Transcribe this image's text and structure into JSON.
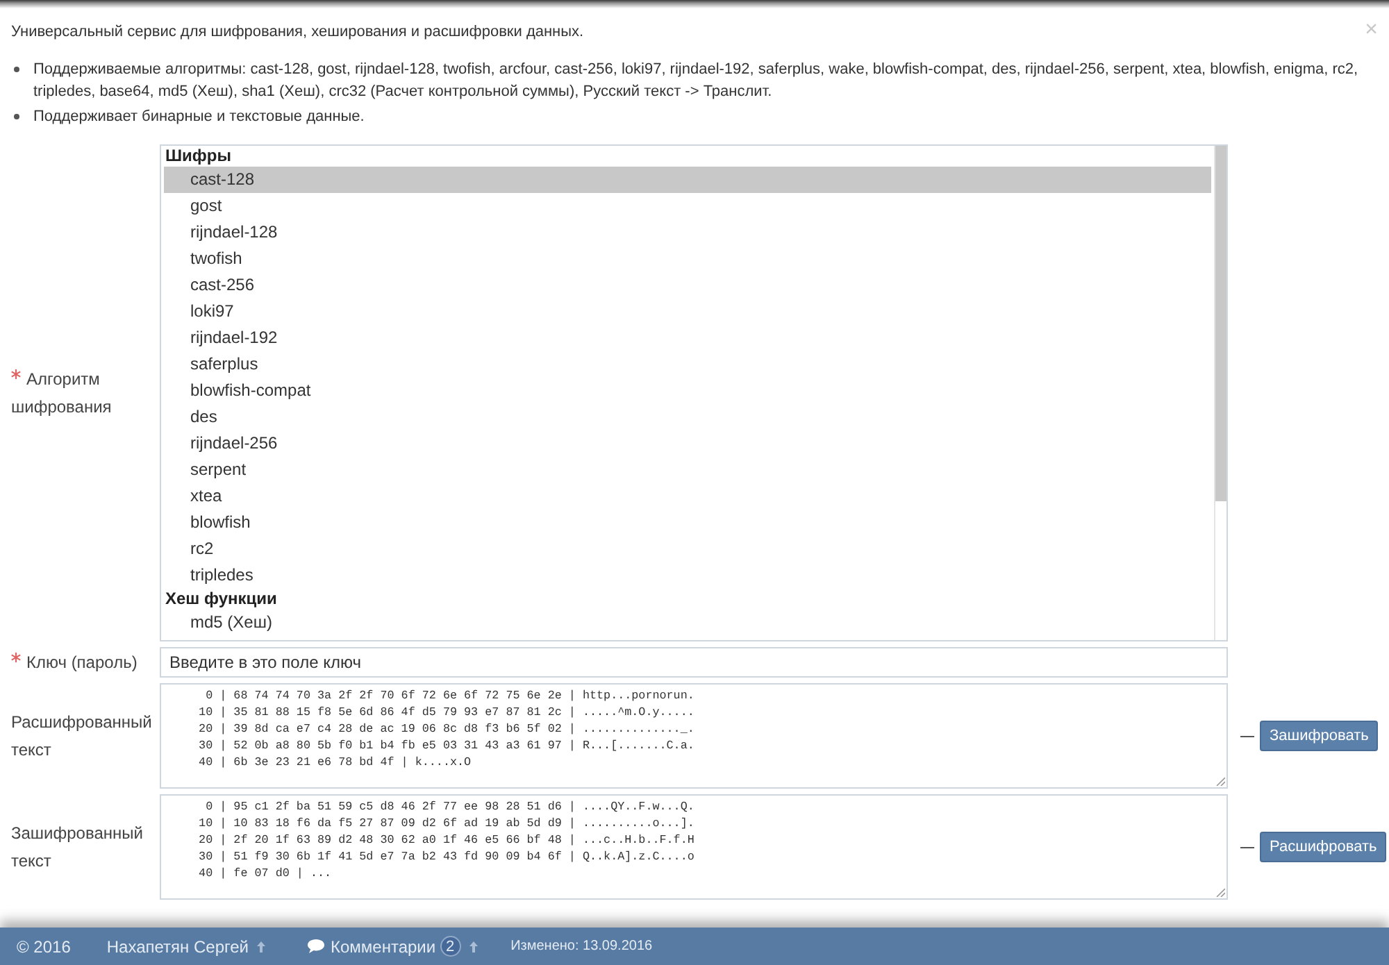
{
  "notice": {
    "title": "Универсальный сервис для шифрования, хеширования и расшифровки данных.",
    "close": "×",
    "features": [
      "Поддерживаемые алгоритмы: cast-128, gost, rijndael-128, twofish, arcfour, cast-256, loki97, rijndael-192, saferplus, wake, blowfish-compat, des, rijndael-256, serpent, xtea, blowfish, enigma, rc2, tripledes, base64, md5 (Хеш), sha1 (Хеш), crc32 (Расчет контрольной суммы), Русский текст -> Транслит.",
      "Поддерживает бинарные и текстовые данные."
    ]
  },
  "form": {
    "fields": [
      {
        "kind": "listbox",
        "label": "Алгоритм шифрования",
        "required": true,
        "groups": [
          {
            "label": "Шифры",
            "options": [
              {
                "label": "cast-128",
                "selected": true
              },
              {
                "label": "gost",
                "selected": false
              },
              {
                "label": "rijndael-128",
                "selected": false
              },
              {
                "label": "twofish",
                "selected": false
              },
              {
                "label": "cast-256",
                "selected": false
              },
              {
                "label": "loki97",
                "selected": false
              },
              {
                "label": "rijndael-192",
                "selected": false
              },
              {
                "label": "saferplus",
                "selected": false
              },
              {
                "label": "blowfish-compat",
                "selected": false
              },
              {
                "label": "des",
                "selected": false
              },
              {
                "label": "rijndael-256",
                "selected": false
              },
              {
                "label": "serpent",
                "selected": false
              },
              {
                "label": "xtea",
                "selected": false
              },
              {
                "label": "blowfish",
                "selected": false
              },
              {
                "label": "rc2",
                "selected": false
              },
              {
                "label": "tripledes",
                "selected": false
              }
            ]
          },
          {
            "label": "Хеш функции",
            "options": [
              {
                "label": "md5 (Хеш)",
                "selected": false
              }
            ]
          }
        ]
      },
      {
        "kind": "input",
        "label": "Ключ (пароль)",
        "required": true,
        "value": "Введите в это поле ключ"
      },
      {
        "kind": "textarea",
        "label": "Расшифрованный текст",
        "required": false,
        "lines": [
          "   0 | 68 74 74 70 3a 2f 2f 70 6f 72 6e 6f 72 75 6e 2e | http...pornorun.",
          "  10 | 35 81 88 15 f8 5e 6d 86 4f d5 79 93 e7 87 81 2c | .....^m.O.y.....",
          "  20 | 39 8d ca e7 c4 28 de ac 19 06 8c d8 f3 b6 5f 02 | .............._.",
          "  30 | 52 0b a8 80 5b f0 b1 b4 fb e5 03 31 43 a3 61 97 | R...[.......C.a.",
          "  40 | 6b 3e 23 21 e6 78 bd 4f | k....x.O"
        ],
        "button": "Зашифровать"
      },
      {
        "kind": "textarea",
        "label": "Зашифрованный текст",
        "required": false,
        "lines": [
          "   0 | 95 c1 2f ba 51 59 c5 d8 46 2f 77 ee 98 28 51 d6 | ....QY..F.w...Q.",
          "  10 | 10 83 18 f6 da f5 27 87 09 d2 6f ad 19 ab 5d d9 | ..........o...].",
          "  20 | 2f 20 1f 63 89 d2 48 30 62 a0 1f 46 e5 66 bf 48 | ...c..H.b..F.f.H",
          "  30 | 51 f9 30 6b 1f 41 5d e7 7a b2 43 fd 90 09 b4 6f | Q..k.A].z.C....o",
          "  40 | fe 07 d0 | ..."
        ],
        "button": "Расшифровать"
      }
    ]
  },
  "footer": {
    "copyright": "© 2016",
    "author": "Нахапетян Сергей",
    "comments_label": "Комментарии",
    "comments_count": "2",
    "modified": "Изменено: 13.09.2016"
  }
}
